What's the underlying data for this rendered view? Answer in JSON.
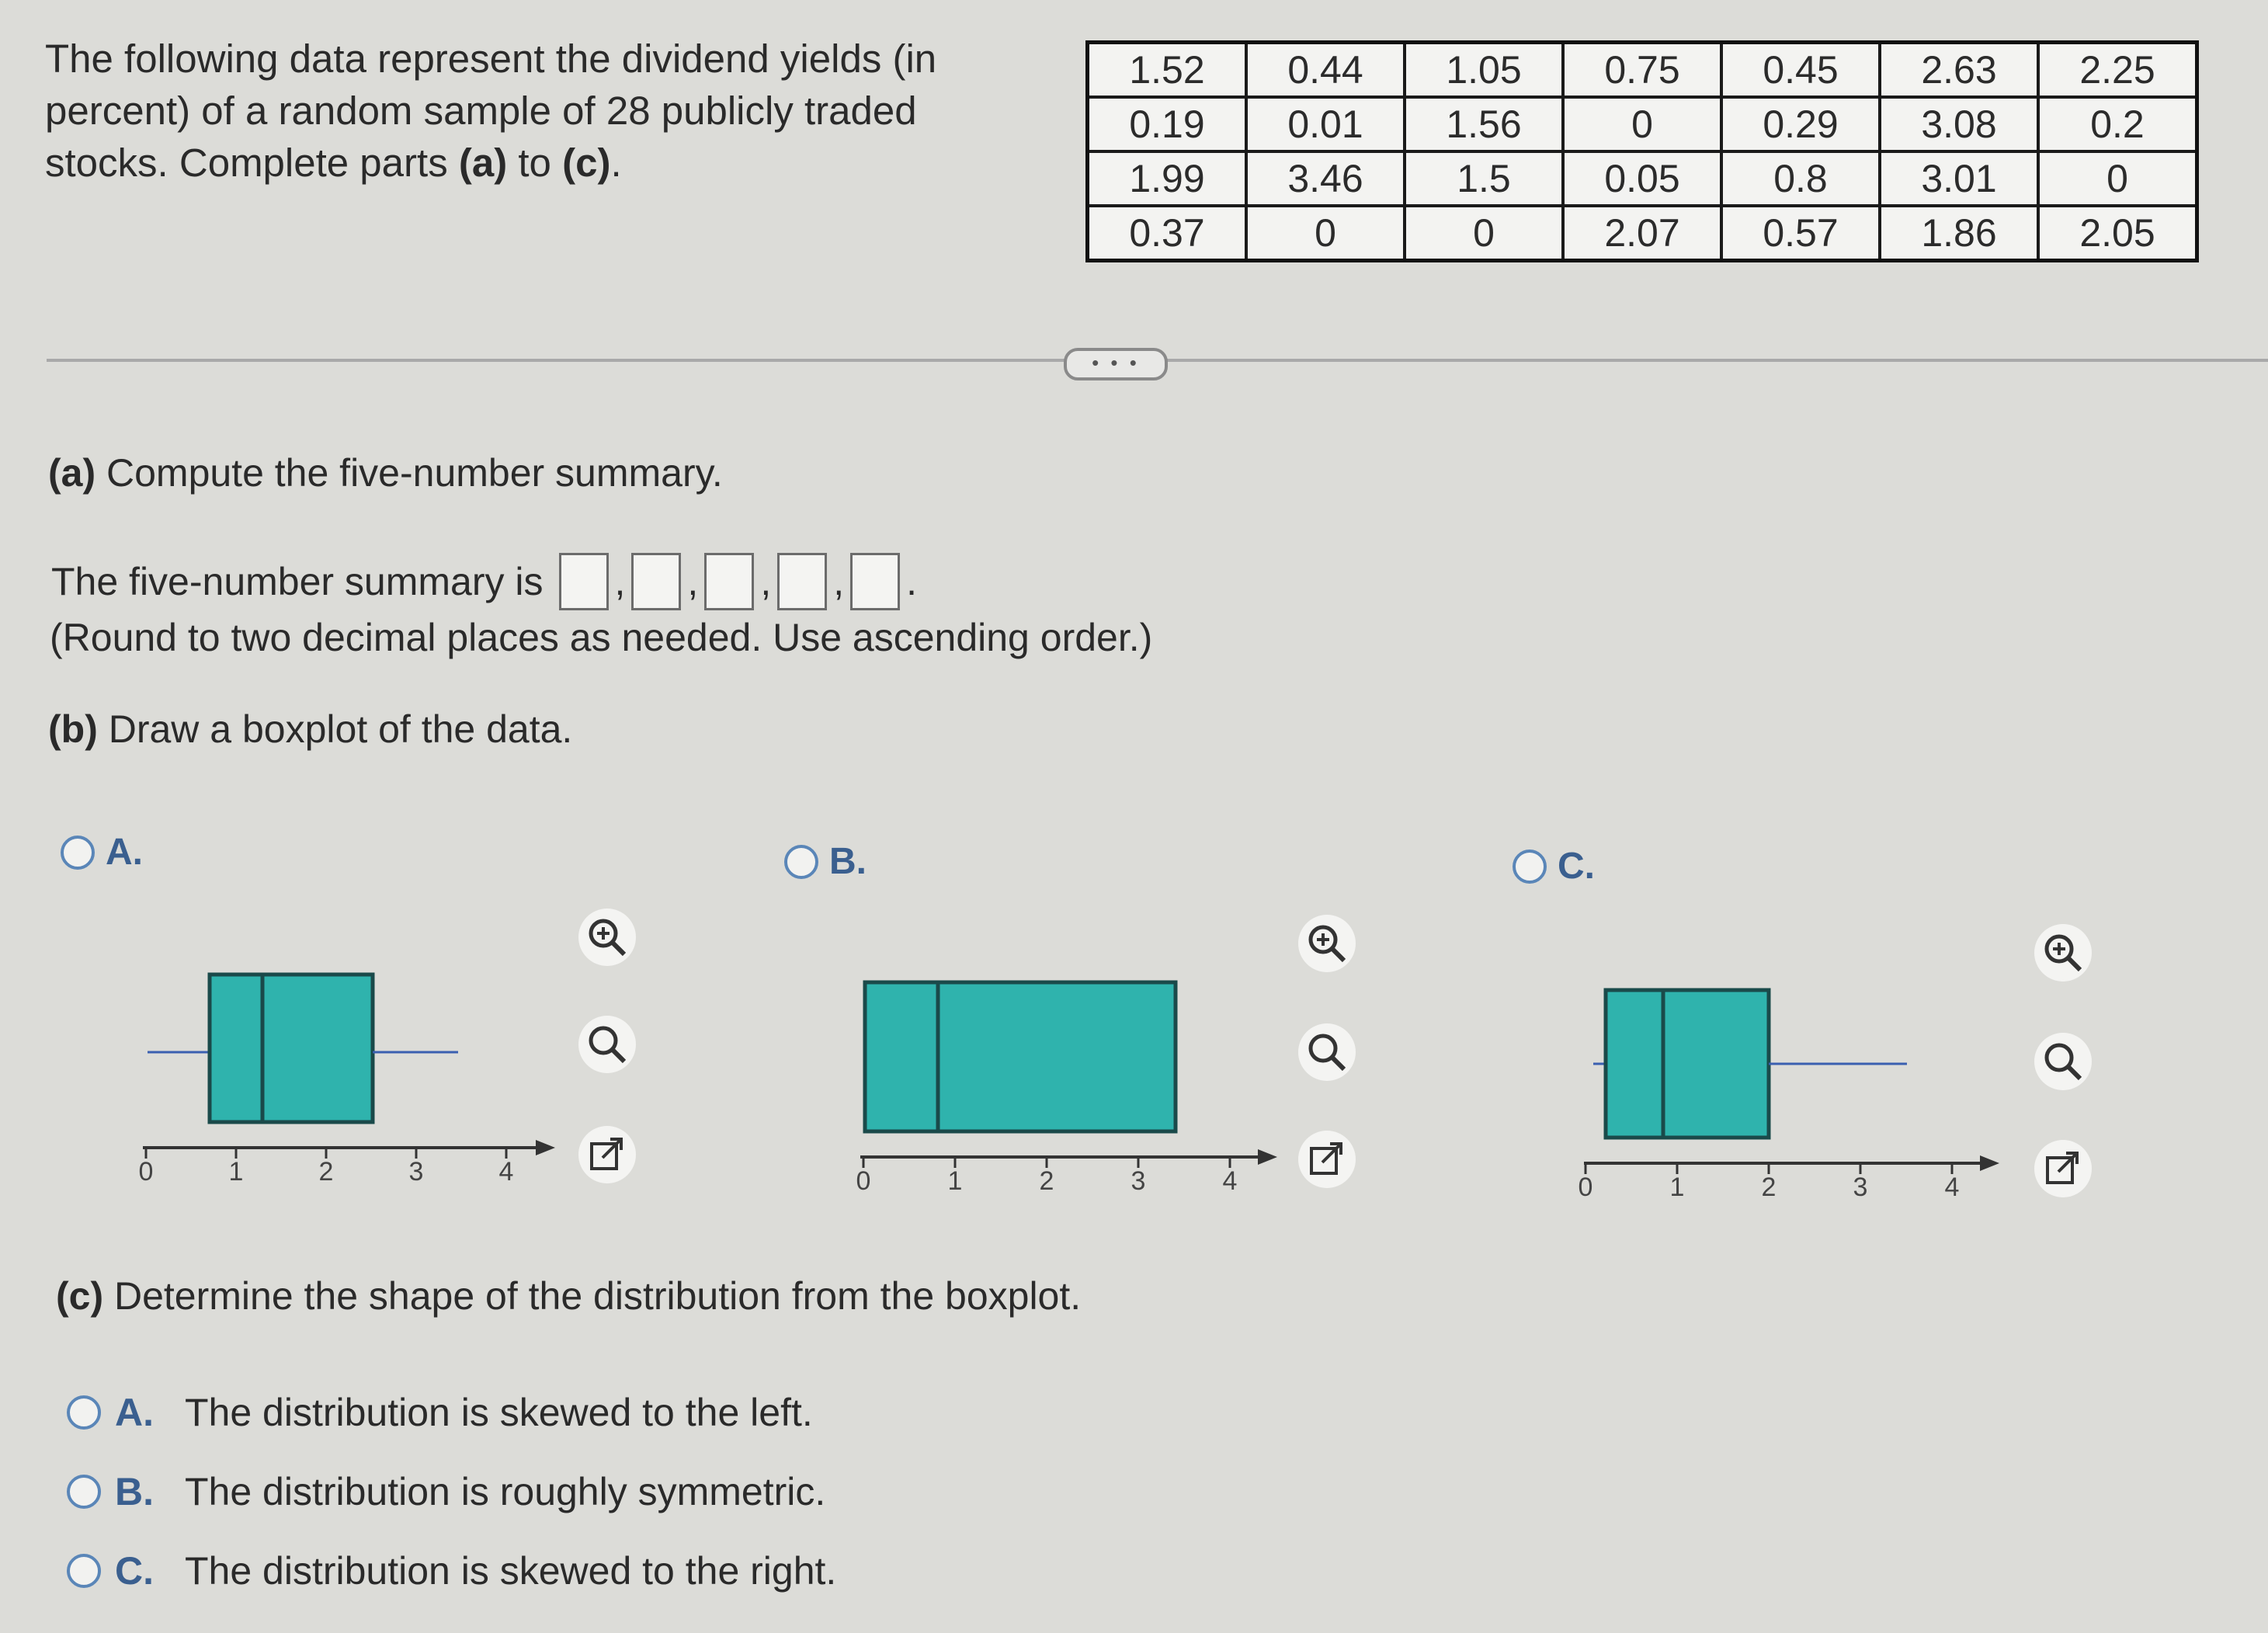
{
  "intro": {
    "text1": "The following data represent the dividend yields (in",
    "text2": "percent) of a random sample of 28 publicly traded",
    "text3_pre": "stocks. Complete parts ",
    "part_a": "(a)",
    "to": " to ",
    "part_c": "(c)",
    "period": "."
  },
  "data_table": [
    [
      "1.52",
      "0.44",
      "1.05",
      "0.75",
      "0.45",
      "2.63",
      "2.25"
    ],
    [
      "0.19",
      "0.01",
      "1.56",
      "0",
      "0.29",
      "3.08",
      "0.2"
    ],
    [
      "1.99",
      "3.46",
      "1.5",
      "0.05",
      "0.8",
      "3.01",
      "0"
    ],
    [
      "0.37",
      "0",
      "0",
      "2.07",
      "0.57",
      "1.86",
      "2.05"
    ]
  ],
  "more_button": "• • •",
  "part_a": {
    "label": "(a)",
    "question": " Compute the five-number summary.",
    "summary_prefix": "The five-number summary is",
    "hint": "(Round to two decimal places as needed. Use ascending order.)"
  },
  "part_b": {
    "label": "(b)",
    "question": " Draw a boxplot of the data.",
    "options": [
      {
        "letter": "A.",
        "ticks": [
          "0",
          "1",
          "2",
          "3",
          "4"
        ]
      },
      {
        "letter": "B.",
        "ticks": [
          "0",
          "1",
          "2",
          "3",
          "4"
        ]
      },
      {
        "letter": "C.",
        "ticks": [
          "0",
          "1",
          "2",
          "3",
          "4"
        ]
      }
    ]
  },
  "part_c": {
    "label": "(c)",
    "question": " Determine the shape of the distribution from the boxplot.",
    "options": [
      {
        "letter": "A.",
        "text": "The distribution is skewed to the left."
      },
      {
        "letter": "B.",
        "text": "The distribution is roughly symmetric."
      },
      {
        "letter": "C.",
        "text": "The distribution is skewed to the right."
      }
    ]
  },
  "icons": {
    "zoom_in": "zoom-in-icon",
    "zoom_out": "zoom-out-icon",
    "popout": "popout-icon"
  },
  "colors": {
    "box_fill": "#2fb3ad",
    "whisker": "#3a5fb0",
    "radio_border": "#5a86b8",
    "option_letter": "#3a5f8f"
  }
}
